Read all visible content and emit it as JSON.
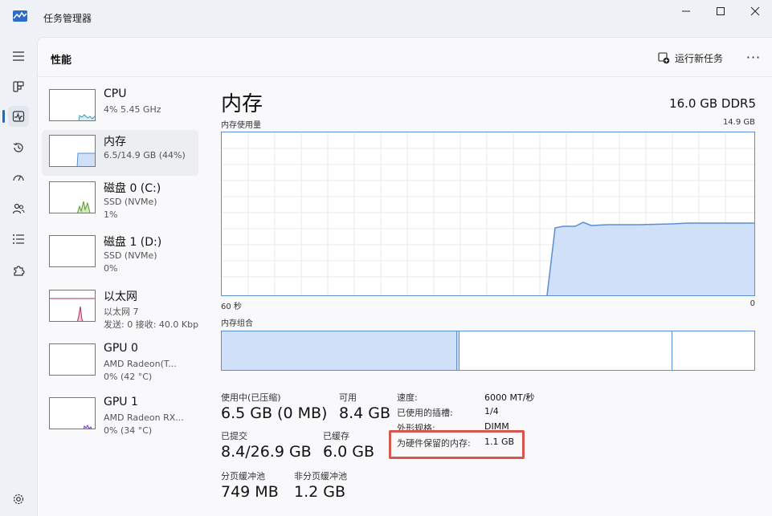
{
  "window": {
    "title": "任务管理器"
  },
  "header": {
    "title": "性能",
    "run_task_label": "运行新任务",
    "more_label": "···"
  },
  "resources": [
    {
      "name": "CPU",
      "sub1": "4% 5.45 GHz",
      "sub2": "",
      "sub3": ""
    },
    {
      "name": "内存",
      "sub1": "6.5/14.9 GB (44%)",
      "sub2": "",
      "sub3": ""
    },
    {
      "name": "磁盘 0 (C:)",
      "sub1": "SSD (NVMe)",
      "sub2": "1%",
      "sub3": ""
    },
    {
      "name": "磁盘 1 (D:)",
      "sub1": "SSD (NVMe)",
      "sub2": "0%",
      "sub3": ""
    },
    {
      "name": "以太网",
      "sub1": "以太网 7",
      "sub2": "发送: 0 接收: 40.0 Kbp",
      "sub3": ""
    },
    {
      "name": "GPU 0",
      "sub1": "AMD Radeon(T...",
      "sub2": "0% (42 °C)",
      "sub3": ""
    },
    {
      "name": "GPU 1",
      "sub1": "AMD Radeon RX...",
      "sub2": "0% (34 °C)",
      "sub3": ""
    }
  ],
  "memory": {
    "title": "内存",
    "spec": "16.0 GB DDR5",
    "usage_label": "内存使用量",
    "max_label": "14.9 GB",
    "time_left": "60 秒",
    "time_right": "0",
    "composition_label": "内存组合",
    "stats": {
      "in_use_label": "使用中(已压缩)",
      "in_use_value": "6.5 GB (0 MB)",
      "available_label": "可用",
      "available_value": "8.4 GB",
      "committed_label": "已提交",
      "committed_value": "8.4/26.9 GB",
      "cached_label": "已缓存",
      "cached_value": "6.0 GB",
      "paged_label": "分页缓冲池",
      "paged_value": "749 MB",
      "nonpaged_label": "非分页缓冲池",
      "nonpaged_value": "1.2 GB"
    },
    "details": {
      "speed_label": "速度:",
      "speed_value": "6000 MT/秒",
      "slots_label": "已使用的插槽:",
      "slots_value": "1/4",
      "form_label": "外形规格:",
      "form_value": "DIMM",
      "reserved_label": "为硬件保留的内存:",
      "reserved_value": "1.1 GB"
    }
  },
  "colors": {
    "accent": "#1a6ac9",
    "graph_line": "#5a8fd6",
    "graph_fill": "#cfe0f8",
    "highlight": "#d9534f"
  }
}
